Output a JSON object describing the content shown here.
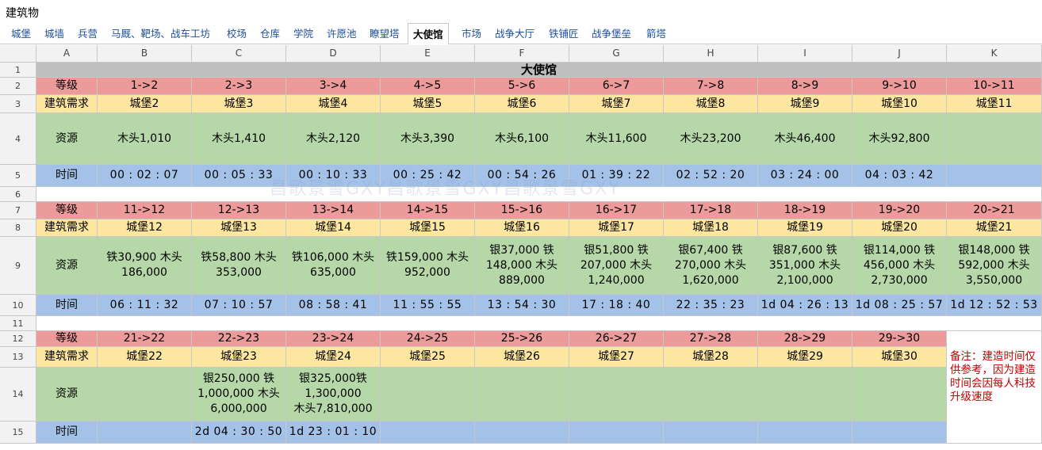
{
  "window_title": "建筑物",
  "tabs": [
    {
      "label": "城堡",
      "active": false
    },
    {
      "label": "城墙",
      "active": false
    },
    {
      "label": "兵营",
      "active": false
    },
    {
      "label": "马厩、靶场、战车工坊",
      "active": false
    },
    {
      "label": "校场",
      "active": false
    },
    {
      "label": "仓库",
      "active": false
    },
    {
      "label": "学院",
      "active": false
    },
    {
      "label": "许愿池",
      "active": false
    },
    {
      "label": "瞭望塔",
      "active": false
    },
    {
      "label": "大使馆",
      "active": true
    },
    {
      "label": "市场",
      "active": false
    },
    {
      "label": "战争大厅",
      "active": false
    },
    {
      "label": "铁铺匠",
      "active": false
    },
    {
      "label": "战争堡垒",
      "active": false
    },
    {
      "label": "箭塔",
      "active": false
    }
  ],
  "columns": [
    "A",
    "B",
    "C",
    "D",
    "E",
    "F",
    "G",
    "H",
    "I",
    "J",
    "K"
  ],
  "row_numbers": [
    "1",
    "2",
    "3",
    "4",
    "5",
    "6",
    "7",
    "8",
    "9",
    "10",
    "11",
    "12",
    "13",
    "14",
    "15"
  ],
  "sheet_title": "大使馆",
  "labels": {
    "level": "等级",
    "requirement": "建筑需求",
    "resources": "资源",
    "time": "时间"
  },
  "blocks": [
    {
      "levels": [
        "1->2",
        "2->3",
        "3->4",
        "4->5",
        "5->6",
        "6->7",
        "7->8",
        "8->9",
        "9->10",
        "10->11"
      ],
      "requirements": [
        "城堡2",
        "城堡3",
        "城堡4",
        "城堡5",
        "城堡6",
        "城堡7",
        "城堡8",
        "城堡9",
        "城堡10",
        "城堡11"
      ],
      "resources": [
        "木头1,010",
        "木头1,410",
        "木头2,120",
        "木头3,390",
        "木头6,100",
        "木头11,600",
        "木头23,200",
        "木头46,400",
        "木头92,800",
        ""
      ],
      "times": [
        "00 : 02 : 07",
        "00 : 05 : 33",
        "00 : 10 : 33",
        "00 : 25 : 42",
        "00 : 54 : 26",
        "01 : 39 : 22",
        "02 : 52 : 20",
        "03 : 24 : 00",
        "04 : 03 : 42",
        ""
      ]
    },
    {
      "levels": [
        "11->12",
        "12->13",
        "13->14",
        "14->15",
        "15->16",
        "16->17",
        "17->18",
        "18->19",
        "19->20",
        "20->21"
      ],
      "requirements": [
        "城堡12",
        "城堡13",
        "城堡14",
        "城堡15",
        "城堡16",
        "城堡17",
        "城堡18",
        "城堡19",
        "城堡20",
        "城堡21"
      ],
      "resources": [
        "铁30,900 木头\n186,000",
        "铁58,800 木头\n353,000",
        "铁106,000 木头\n635,000",
        "铁159,000 木头\n952,000",
        "银37,000 铁\n148,000 木头\n889,000",
        "银51,800 铁\n207,000 木头\n1,240,000",
        "银67,400 铁\n270,000 木头\n1,620,000",
        "银87,600 铁\n351,000 木头\n2,100,000",
        "银114,000 铁\n456,000 木头\n2,730,000",
        "银148,000 铁\n592,000 木头\n3,550,000"
      ],
      "times": [
        "06 : 11 : 32",
        "07 : 10 : 57",
        "08 : 58 : 41",
        "11 : 55 : 55",
        "13 : 54 : 30",
        "17 : 18 : 40",
        "22 : 35 : 23",
        "1d 04 : 26 : 13",
        "1d 08 : 25 : 57",
        "1d 12 : 52 : 53"
      ]
    },
    {
      "levels": [
        "21->22",
        "22->23",
        "23->24",
        "24->25",
        "25->26",
        "26->27",
        "27->28",
        "28->29",
        "29->30"
      ],
      "requirements": [
        "城堡22",
        "城堡23",
        "城堡24",
        "城堡25",
        "城堡26",
        "城堡27",
        "城堡28",
        "城堡29",
        "城堡30"
      ],
      "resources": [
        "",
        "银250,000 铁\n1,000,000 木头\n6,000,000",
        "银325,000铁\n1,300,000\n木头7,810,000",
        "",
        "",
        "",
        "",
        "",
        ""
      ],
      "times": [
        "",
        "2d 04 : 30 : 50",
        "1d 23 : 01 : 10",
        "",
        "",
        "",
        "",
        "",
        ""
      ]
    }
  ],
  "note": "备注：建造时间仅供参考，因为建造时间会因每人科技升级速度",
  "watermark": "昌歌景雪GXY昌歌景雪GXY昌歌景雪GXY",
  "colors": {
    "level_row": "#ec9a9a",
    "requirement_row": "#fde6a0",
    "resource_row": "#b6d7a8",
    "time_row": "#a4c2e8",
    "title_row": "#bfbfbf",
    "note_text": "#c00000"
  }
}
